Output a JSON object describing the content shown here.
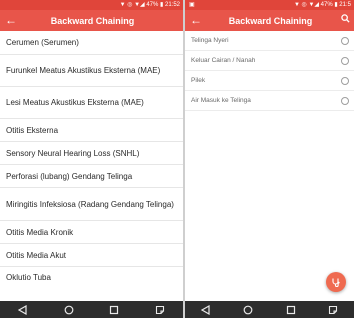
{
  "left": {
    "status": {
      "icons": "▼ ◎ ▼◢ 47% ▮ 21:52"
    },
    "appbar": {
      "back_icon": "back-arrow-icon",
      "title": "Backward Chaining"
    },
    "items": [
      "Cerumen (Serumen)",
      "Furunkel Meatus Akustikus Eksterna (MAE)",
      "Lesi Meatus Akustikus Eksterna (MAE)",
      "Otitis Eksterna",
      "Sensory Neural Hearing Loss (SNHL)",
      "Perforasi (lubang) Gendang Telinga",
      "Miringitis Infeksiosa (Radang Gendang Telinga)",
      "Otitis Media Kronik",
      "Otitis Media Akut",
      "Oklutio Tuba"
    ]
  },
  "right": {
    "status": {
      "left": "▣",
      "icons": "▼ ◎ ▼◢ 47% ▮ 21:5"
    },
    "appbar": {
      "back_icon": "back-arrow-icon",
      "title": "Backward Chaining",
      "search_icon": "search-icon"
    },
    "symptoms": [
      {
        "label": "Telinga Nyeri",
        "selected": false
      },
      {
        "label": "Keluar Cairan / Nanah",
        "selected": false
      },
      {
        "label": "Pilek",
        "selected": false
      },
      {
        "label": "Air Masuk ke Telinga",
        "selected": false
      }
    ],
    "fab": {
      "icon": "diagnose-icon",
      "color": "#ef6a50"
    }
  },
  "colors": {
    "accent": "#e8554a",
    "statusbar": "#e0453a",
    "navbar": "#2d2d2d"
  }
}
